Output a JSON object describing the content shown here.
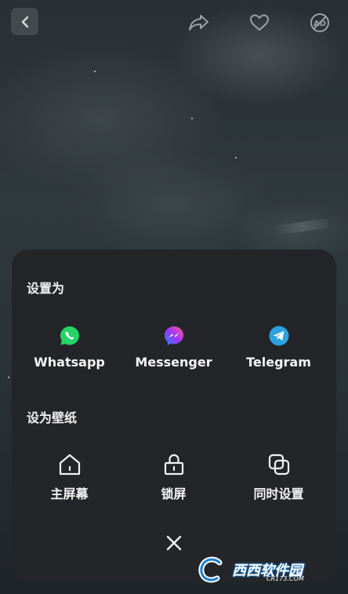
{
  "wallpaper": {
    "description_icon": "wallpaper-image"
  },
  "toolbar": {
    "back_icon": "chevron-left-icon",
    "share_icon": "share-arrow-icon",
    "favorite_icon": "heart-icon",
    "ad_icon": "ad-block-icon",
    "ad_icon_text": "AD"
  },
  "sheet": {
    "set_as_title": "设置为",
    "apps": [
      {
        "label": "Whatsapp",
        "icon": "whatsapp-icon",
        "color": "#25D366"
      },
      {
        "label": "Messenger",
        "icon": "messenger-icon",
        "color": "#8A4DFF"
      },
      {
        "label": "Telegram",
        "icon": "telegram-icon",
        "color": "#2AA3DF"
      }
    ],
    "wallpaper_title": "设为壁纸",
    "wallpaper_options": [
      {
        "label": "主屏幕",
        "icon": "home-icon"
      },
      {
        "label": "锁屏",
        "icon": "lock-icon"
      },
      {
        "label": "同时设置",
        "icon": "both-screens-icon"
      }
    ],
    "close_icon": "close-icon"
  },
  "watermark": {
    "brand": "西西软件园",
    "site": "CR173.COM",
    "logo_letter": "C"
  },
  "colors": {
    "sheet_bg": "#242528",
    "text": "#f5f5f5"
  }
}
